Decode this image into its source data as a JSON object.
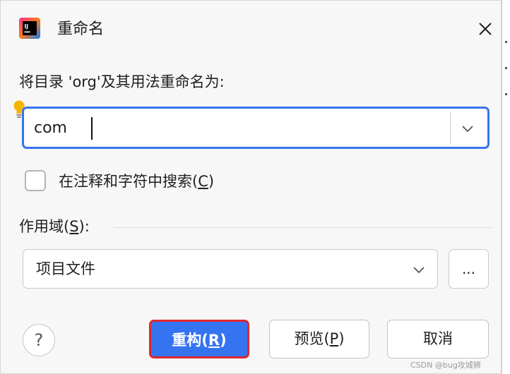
{
  "dialog": {
    "title": "重命名",
    "app_icon": "intellij-idea-icon",
    "close_icon": "close-icon"
  },
  "rename": {
    "prompt": "将目录 'org'及其用法重命名为:",
    "new_name": "com",
    "hint_icon": "lightbulb-icon",
    "history_icon": "chevron-down-icon"
  },
  "search_comments": {
    "label_main": "在注释和字符中搜索(",
    "mnemonic": "C",
    "label_tail": ")",
    "checked": false
  },
  "scope": {
    "label_main": "作用域(",
    "mnemonic": "S",
    "label_tail": "):",
    "selected": "项目文件",
    "browse_label": "..."
  },
  "buttons": {
    "help": "?",
    "refactor_main": "重构(",
    "refactor_mnemonic": "R",
    "refactor_tail": ")",
    "preview_main": "预览(",
    "preview_mnemonic": "P",
    "preview_tail": ")",
    "cancel": "取消"
  },
  "colors": {
    "accent": "#3574f0",
    "highlight_border": "#e0262d",
    "hint_bulb": "#f5b400"
  },
  "watermark": "CSDN @bug攻城狮"
}
